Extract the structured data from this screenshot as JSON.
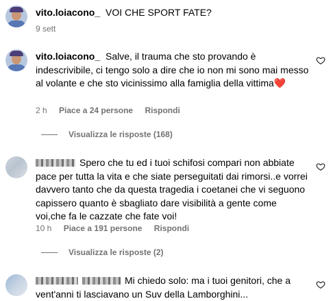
{
  "post": {
    "username": "vito.loiacono_",
    "caption": "VOI CHE SPORT FATE?",
    "date": "9 sett"
  },
  "comments": [
    {
      "username": "vito.loiacono_",
      "text": "Salve, il trauma che sto provando è indescrivibile, ci tengo solo a dire che io non mi sono mai messo al volante e che sto vicinissimo alla famiglia della vittima",
      "emoji": "❤️",
      "time": "2 h",
      "likes": "Piace a 24 persone",
      "reply_label": "Rispondi",
      "view_replies": "Visualizza le risposte (168)"
    },
    {
      "username": "",
      "text": "Spero che tu ed i tuoi schifosi compari non abbiate pace per tutta la vita e che siate perseguitati dai rimorsi..e vorrei davvero tanto che da questa tragedia i coetanei che vi seguono capissero quanto è sbagliato dare visibilità a gente come voi,che fa le cazzate che fate voi!",
      "time": "10 h",
      "likes": "Piace a 191 persone",
      "reply_label": "Rispondi",
      "view_replies": "Visualizza le risposte (2)"
    },
    {
      "username": "",
      "text": "Mi chiedo solo: ma i tuoi genitori, che a vent'anni ti lasciavano un Suv della Lamborghini..."
    }
  ],
  "icons": {
    "like": "heart-outline-icon"
  }
}
